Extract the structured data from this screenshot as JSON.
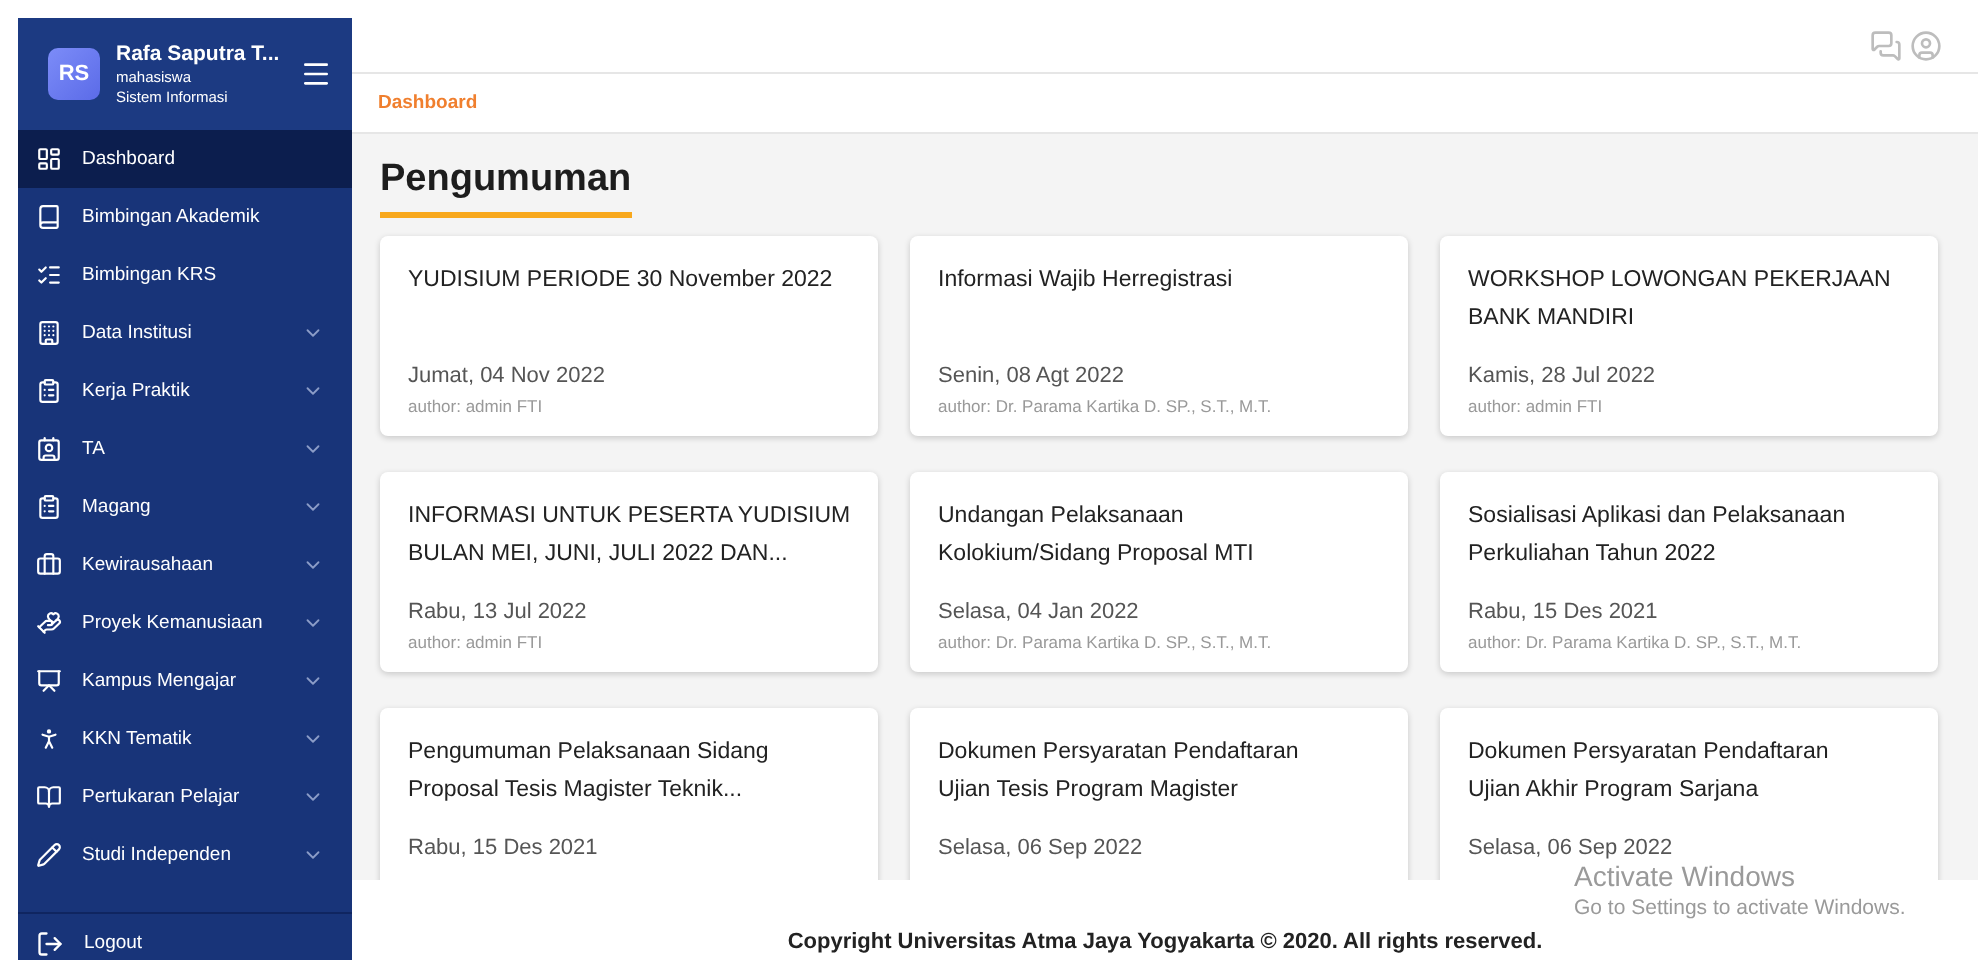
{
  "sidebar": {
    "avatar": "RS",
    "user_name": "Rafa Saputra T...",
    "role": "mahasiswa",
    "program": "Sistem Informasi",
    "items": [
      {
        "label": "Dashboard",
        "selected": true,
        "expandable": false
      },
      {
        "label": "Bimbingan Akademik",
        "selected": false,
        "expandable": false
      },
      {
        "label": "Bimbingan KRS",
        "selected": false,
        "expandable": false
      },
      {
        "label": "Data Institusi",
        "selected": false,
        "expandable": true
      },
      {
        "label": "Kerja Praktik",
        "selected": false,
        "expandable": true
      },
      {
        "label": "TA",
        "selected": false,
        "expandable": true
      },
      {
        "label": "Magang",
        "selected": false,
        "expandable": true
      },
      {
        "label": "Kewirausahaan",
        "selected": false,
        "expandable": true
      },
      {
        "label": "Proyek Kemanusiaan",
        "selected": false,
        "expandable": true
      },
      {
        "label": "Kampus Mengajar",
        "selected": false,
        "expandable": true
      },
      {
        "label": "KKN Tematik",
        "selected": false,
        "expandable": true
      },
      {
        "label": "Pertukaran Pelajar",
        "selected": false,
        "expandable": true
      },
      {
        "label": "Studi Independen",
        "selected": false,
        "expandable": true
      }
    ],
    "logout": "Logout"
  },
  "breadcrumb": "Dashboard",
  "heading": "Pengumuman",
  "announcements": [
    {
      "title_lines": [
        "YUDISIUM PERIODE 30 November 2022"
      ],
      "date": "Jumat, 04 Nov 2022",
      "author": "author: admin FTI"
    },
    {
      "title_lines": [
        "Informasi Wajib Herregistrasi"
      ],
      "date": "Senin, 08 Agt 2022",
      "author": "author: Dr. Parama Kartika D. SP., S.T., M.T."
    },
    {
      "title_lines": [
        "WORKSHOP LOWONGAN PEKERJAAN",
        "BANK MANDIRI"
      ],
      "date": "Kamis, 28 Jul 2022",
      "author": "author: admin FTI"
    },
    {
      "title_lines": [
        "INFORMASI UNTUK PESERTA YUDISIUM",
        "BULAN MEI, JUNI, JULI 2022 DAN..."
      ],
      "date": "Rabu, 13 Jul 2022",
      "author": "author: admin FTI"
    },
    {
      "title_lines": [
        "Undangan Pelaksanaan",
        "Kolokium/Sidang Proposal MTI"
      ],
      "date": "Selasa, 04 Jan 2022",
      "author": "author: Dr. Parama Kartika D. SP., S.T., M.T."
    },
    {
      "title_lines": [
        "Sosialisasi Aplikasi dan Pelaksanaan",
        "Perkuliahan Tahun 2022"
      ],
      "date": "Rabu, 15 Des 2021",
      "author": "author: Dr. Parama Kartika D. SP., S.T., M.T."
    },
    {
      "title_lines": [
        "Pengumuman Pelaksanaan Sidang",
        "Proposal Tesis Magister Teknik..."
      ],
      "date": "Rabu, 15 Des 2021"
    },
    {
      "title_lines": [
        "Dokumen Persyaratan Pendaftaran",
        "Ujian Tesis Program Magister"
      ],
      "date": "Selasa, 06 Sep 2022"
    },
    {
      "title_lines": [
        "Dokumen Persyaratan Pendaftaran",
        "Ujian Akhir Program Sarjana"
      ],
      "date": "Selasa, 06 Sep 2022"
    }
  ],
  "footer": "Copyright Universitas Atma Jaya Yogyakarta © 2020. All rights reserved.",
  "activation_notice": {
    "title": "Activate Windows",
    "message": "Go to Settings to activate Windows."
  }
}
